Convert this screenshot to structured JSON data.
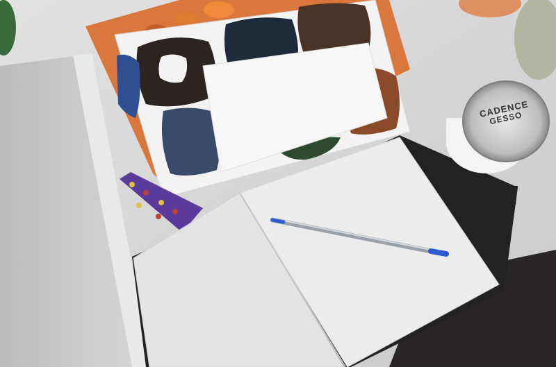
{
  "scene": {
    "jar": {
      "brand": "CADENCE",
      "product": "GESSO"
    }
  },
  "colors": {
    "desk": "#d9d9d9",
    "laptop": "#c4c6c7",
    "notebook_page": "#e6e6e6",
    "notebook_cover": "#222222",
    "orange_book": "#d9773d",
    "paint_black": "#2b2420",
    "paint_navy": "#1f2a3a",
    "paint_brown": "#4a3428",
    "paint_rust": "#8a4a2a",
    "paint_blue": "#3a4a6a",
    "pen_blue": "#2d5bd1",
    "bookmark_purple": "#5a3a9a"
  }
}
